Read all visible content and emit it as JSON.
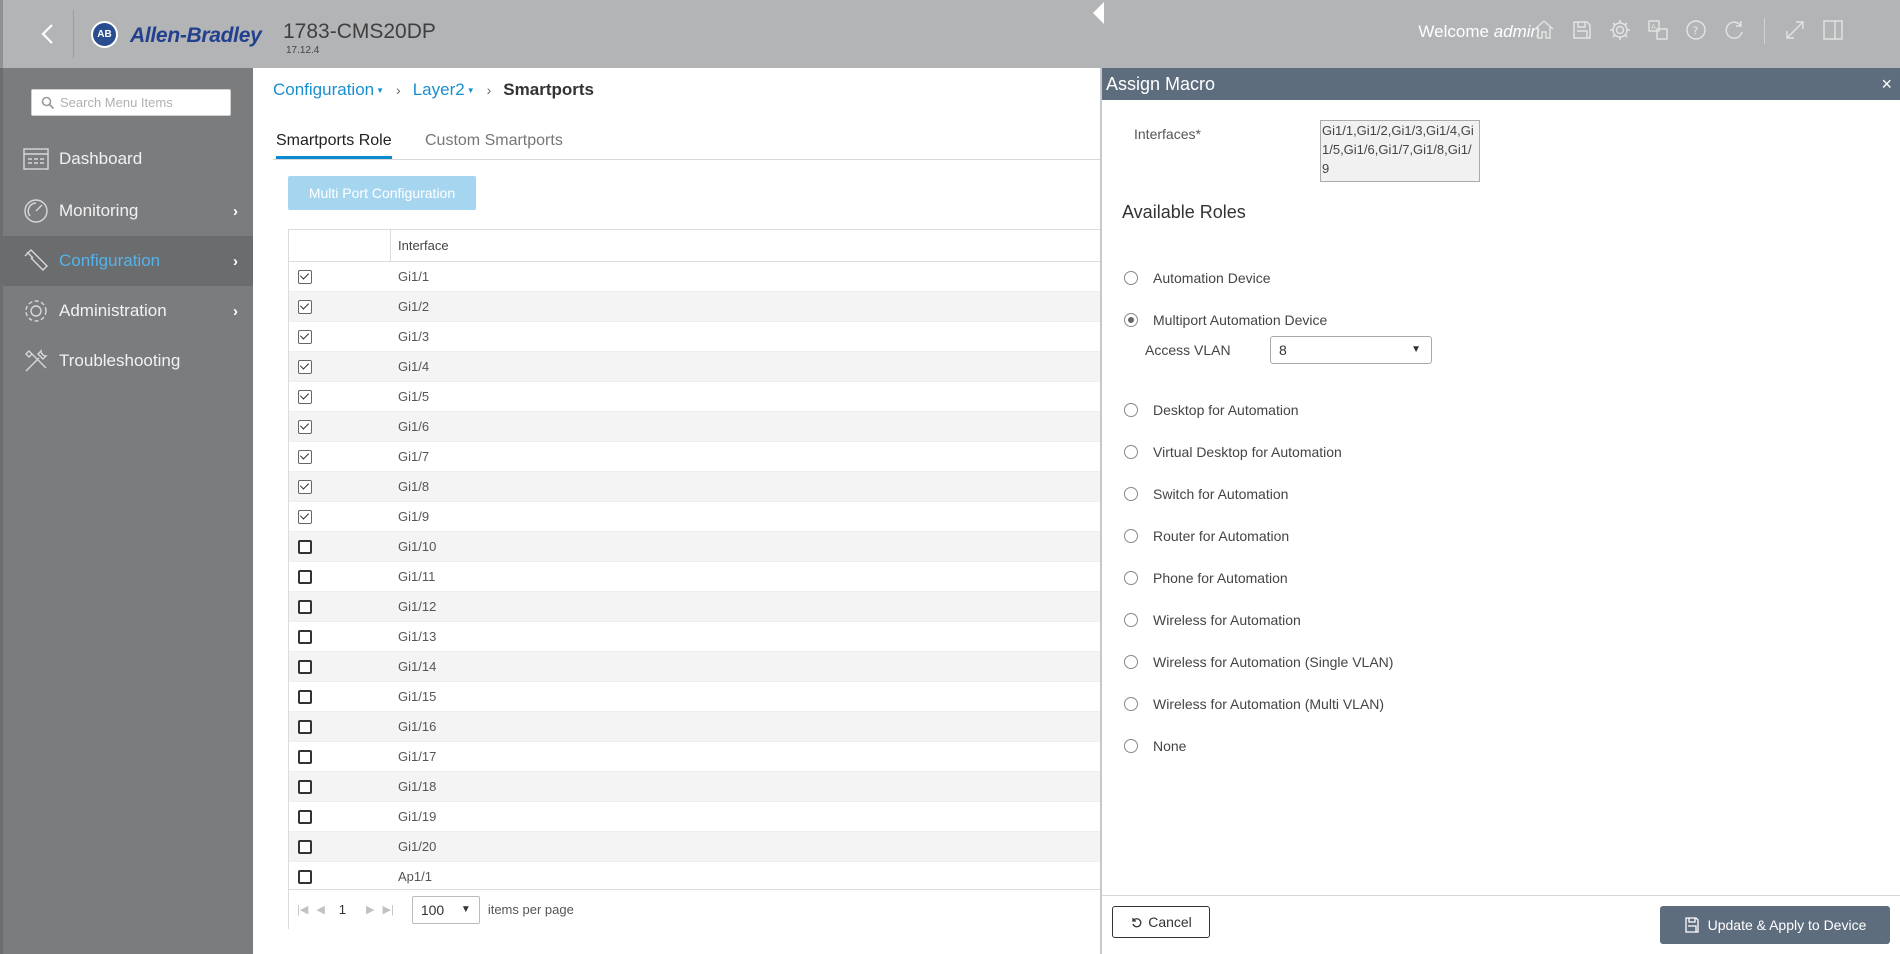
{
  "header": {
    "brand_badge": "AB",
    "brand_name": "Allen-Bradley",
    "device_name": "1783-CMS20DP",
    "device_version": "17.12.4",
    "welcome_prefix": "Welcome",
    "welcome_user": "admin",
    "icons": [
      "home-icon",
      "save-icon",
      "gear-icon",
      "translate-icon",
      "help-icon",
      "refresh-icon",
      "expand-icon",
      "split-panel-icon"
    ]
  },
  "sidebar": {
    "search_placeholder": "Search Menu Items",
    "items": [
      {
        "label": "Dashboard",
        "icon": "dashboard-icon",
        "has_children": false
      },
      {
        "label": "Monitoring",
        "icon": "monitoring-icon",
        "has_children": true
      },
      {
        "label": "Configuration",
        "icon": "wrench-icon",
        "has_children": true,
        "active": true
      },
      {
        "label": "Administration",
        "icon": "gear-icon",
        "has_children": true
      },
      {
        "label": "Troubleshooting",
        "icon": "tools-icon",
        "has_children": false
      }
    ]
  },
  "breadcrumb": {
    "level1": "Configuration",
    "level2": "Layer2",
    "current": "Smartports"
  },
  "tabs": {
    "active": "Smartports Role",
    "inactive": "Custom Smartports"
  },
  "multi_port_button": "Multi Port Configuration",
  "grid": {
    "column_header": "Interface",
    "rows": [
      {
        "iface": "Gi1/1",
        "checked": true
      },
      {
        "iface": "Gi1/2",
        "checked": true
      },
      {
        "iface": "Gi1/3",
        "checked": true
      },
      {
        "iface": "Gi1/4",
        "checked": true
      },
      {
        "iface": "Gi1/5",
        "checked": true
      },
      {
        "iface": "Gi1/6",
        "checked": true
      },
      {
        "iface": "Gi1/7",
        "checked": true
      },
      {
        "iface": "Gi1/8",
        "checked": true
      },
      {
        "iface": "Gi1/9",
        "checked": true
      },
      {
        "iface": "Gi1/10",
        "checked": false
      },
      {
        "iface": "Gi1/11",
        "checked": false
      },
      {
        "iface": "Gi1/12",
        "checked": false
      },
      {
        "iface": "Gi1/13",
        "checked": false
      },
      {
        "iface": "Gi1/14",
        "checked": false
      },
      {
        "iface": "Gi1/15",
        "checked": false
      },
      {
        "iface": "Gi1/16",
        "checked": false
      },
      {
        "iface": "Gi1/17",
        "checked": false
      },
      {
        "iface": "Gi1/18",
        "checked": false
      },
      {
        "iface": "Gi1/19",
        "checked": false
      },
      {
        "iface": "Gi1/20",
        "checked": false
      },
      {
        "iface": "Ap1/1",
        "checked": false
      }
    ],
    "pager": {
      "page": "1",
      "items_per_page": "100",
      "items_label": "items per page"
    }
  },
  "panel": {
    "title": "Assign Macro",
    "close": "×",
    "interfaces_label": "Interfaces*",
    "interfaces_value": "Gi1/1,Gi1/2,Gi1/3,Gi1/4,Gi1/5,Gi1/6,Gi1/7,Gi1/8,Gi1/9",
    "available_roles_title": "Available Roles",
    "roles": [
      {
        "label": "Automation Device",
        "selected": false
      },
      {
        "label": "Multiport Automation Device",
        "selected": true
      },
      {
        "label": "Desktop for Automation",
        "selected": false
      },
      {
        "label": "Virtual Desktop for Automation",
        "selected": false
      },
      {
        "label": "Switch for Automation",
        "selected": false
      },
      {
        "label": "Router for Automation",
        "selected": false
      },
      {
        "label": "Phone for Automation",
        "selected": false
      },
      {
        "label": "Wireless for Automation",
        "selected": false
      },
      {
        "label": "Wireless for Automation (Single VLAN)",
        "selected": false
      },
      {
        "label": "Wireless for Automation (Multi VLAN)",
        "selected": false
      },
      {
        "label": "None",
        "selected": false
      }
    ],
    "access_vlan_label": "Access VLAN",
    "access_vlan_value": "8",
    "cancel_button": "Cancel",
    "apply_button": "Update & Apply to Device"
  }
}
